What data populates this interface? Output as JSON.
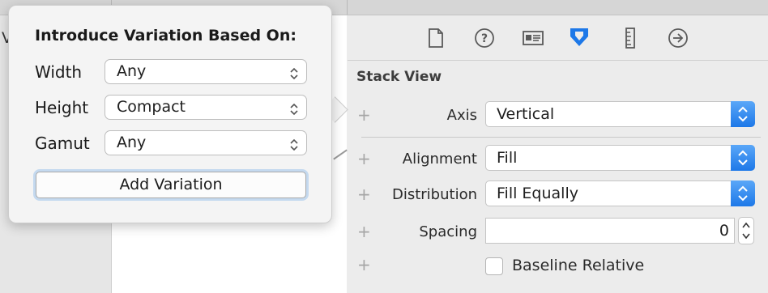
{
  "background": {
    "left_edge_text": "V"
  },
  "inspector": {
    "toolbar_icons": [
      "file-inspector-icon",
      "quick-help-icon",
      "identity-inspector-icon",
      "attributes-inspector-icon",
      "size-inspector-icon",
      "connections-inspector-icon"
    ],
    "active_icon": "attributes-inspector-icon",
    "section_title": "Stack View",
    "axis": {
      "label": "Axis",
      "value": "Vertical"
    },
    "alignment": {
      "label": "Alignment",
      "value": "Fill"
    },
    "distribution": {
      "label": "Distribution",
      "value": "Fill Equally"
    },
    "spacing": {
      "label": "Spacing",
      "value": "0"
    },
    "baseline": {
      "label": "Baseline Relative",
      "checked": false
    },
    "plus_symbol": "+",
    "accent_color": "#1d78e8"
  },
  "popover": {
    "title": "Introduce Variation Based On:",
    "width": {
      "label": "Width",
      "value": "Any"
    },
    "height": {
      "label": "Height",
      "value": "Compact"
    },
    "gamut": {
      "label": "Gamut",
      "value": "Any"
    },
    "add_button": "Add Variation"
  }
}
